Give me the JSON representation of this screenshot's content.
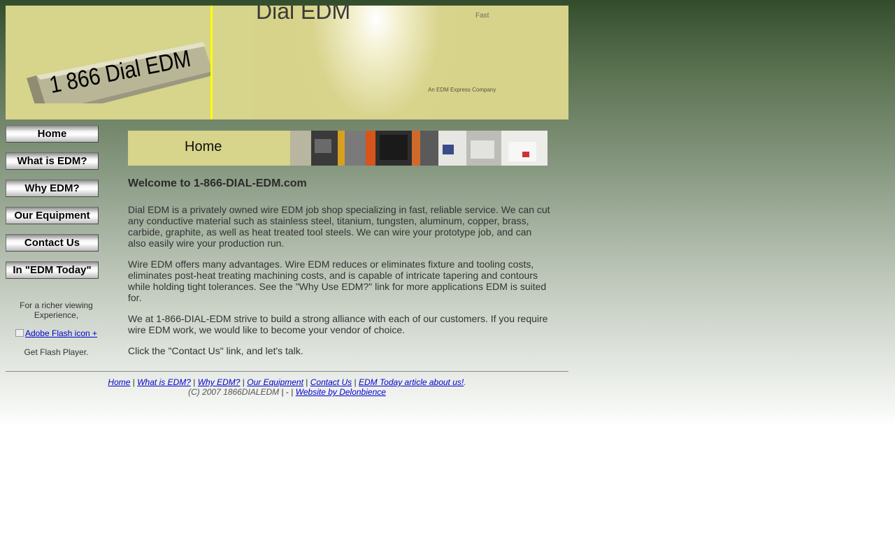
{
  "banner": {
    "title": "Dial EDM",
    "brick_text": "1 866 Dial EDM",
    "tagline": "Fast",
    "company": "An EDM Express Company"
  },
  "nav": [
    {
      "label": "Home"
    },
    {
      "label": "What is EDM?"
    },
    {
      "label": "Why EDM?"
    },
    {
      "label": "Our Equipment"
    },
    {
      "label": "Contact Us"
    },
    {
      "label": "In \"EDM Today\""
    }
  ],
  "flash": {
    "text_before": "For a richer viewing Experience,",
    "link_alt": "Adobe Flash icon +",
    "text_after": "Get Flash Player."
  },
  "header": {
    "label": "Home"
  },
  "content": {
    "heading": "Welcome to 1-866-DIAL-EDM.com",
    "paragraphs": [
      "Dial EDM is a privately owned wire EDM job shop specializing in fast, reliable service. We can cut any conductive material such as stainless steel, titanium, tungsten, aluminum, copper, brass, carbide, graphite, as well as heat treated tool steels. We can wire your prototype job, and can also easily wire your production run.",
      "Wire EDM offers many advantages. Wire EDM reduces or eliminates fixture and tooling costs, eliminates post-heat treating machining costs, and is capable of intricate tapering and contours while holding tight tolerances. See the \"Why Use EDM?\" link for more applications EDM is suited for.",
      "We at 1-866-DIAL-EDM strive to build a strong alliance with each of our customers. If you require wire EDM work, we would like to become your vendor of choice.",
      "Click the \"Contact Us\" link, and let's talk."
    ]
  },
  "footer": {
    "links": [
      "Home",
      "What is EDM?",
      "Why EDM?",
      "Our Equipment",
      "Contact Us",
      "EDM Today article about us!"
    ],
    "separator": "|",
    "end": ".",
    "copyright": "(C) 2007 1866DIALEDM",
    "mid_sep": "| - |",
    "credit": "Website by Delonbience"
  },
  "colors": {
    "banner_yellow": "#d7d48b",
    "accent_line": "#ffff00",
    "link": "#0000cc"
  }
}
